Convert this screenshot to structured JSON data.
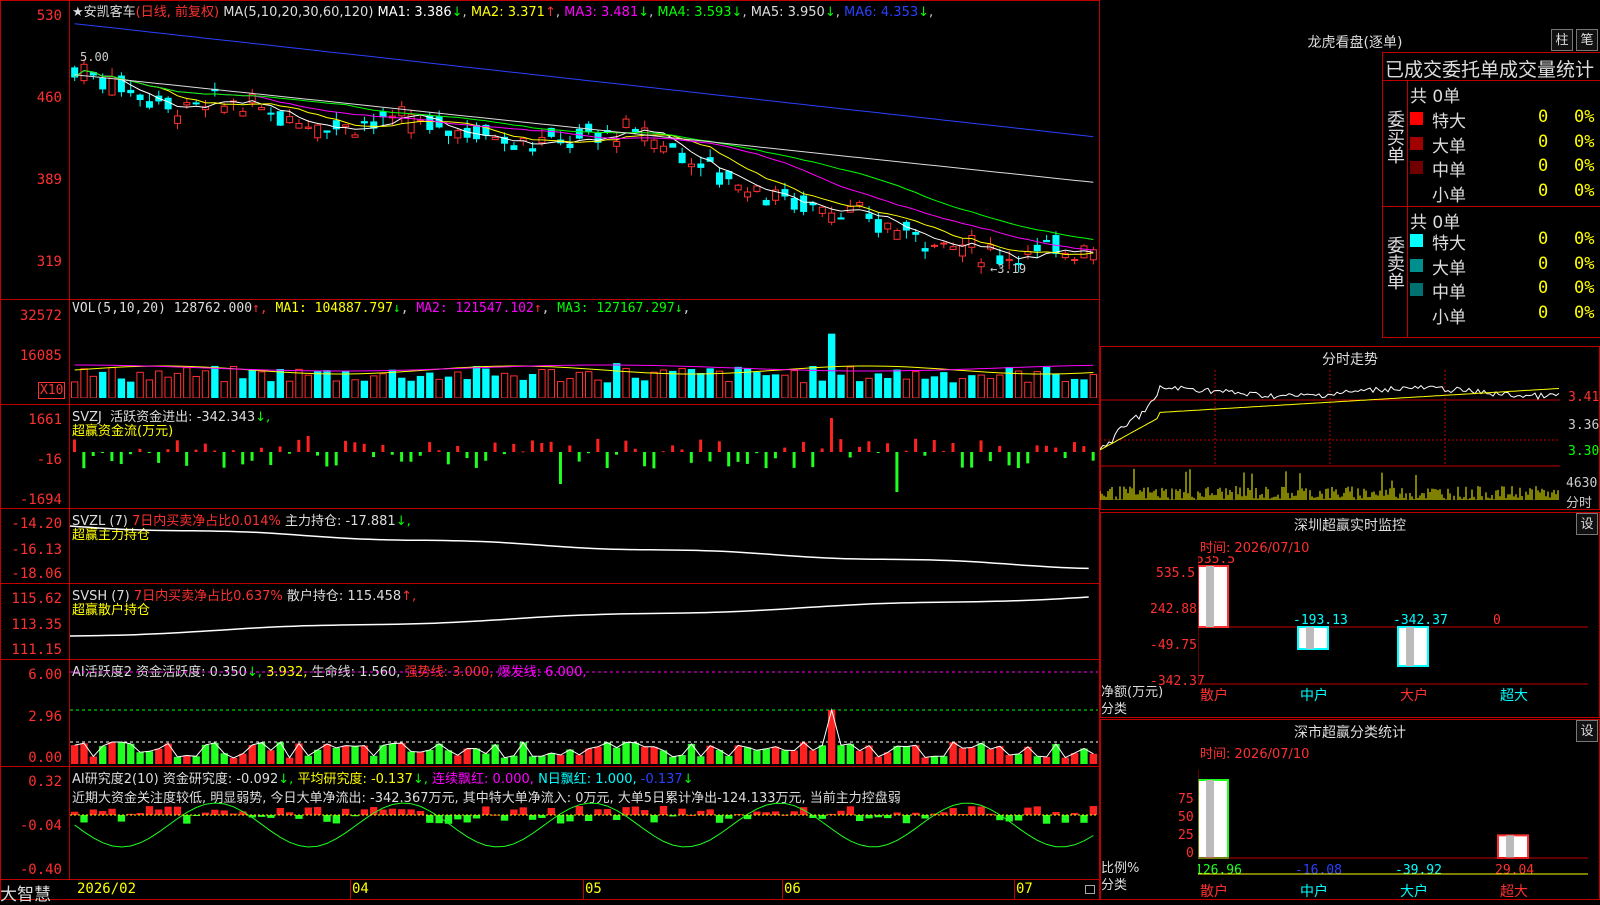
{
  "stock": {
    "name": "★安凯客车",
    "mode": "(日线, 前复权)",
    "ma_label": "MA(5,10,20,30,60,120)",
    "ma": [
      {
        "k": "MA1",
        "v": "3.386",
        "arrow": "↓",
        "color": "#ffffff"
      },
      {
        "k": "MA2",
        "v": "3.371",
        "arrow": "↑",
        "color": "#ffff00"
      },
      {
        "k": "MA3",
        "v": "3.481",
        "arrow": "↓",
        "color": "#ff00ff"
      },
      {
        "k": "MA4",
        "v": "3.593",
        "arrow": "↓",
        "color": "#00ff00"
      },
      {
        "k": "MA5",
        "v": "3.950",
        "arrow": "↓",
        "color": "#dddddd"
      },
      {
        "k": "MA6",
        "v": "4.353",
        "arrow": "↓",
        "color": "#2a40ff"
      }
    ],
    "price_axis": [
      "530",
      "460",
      "389",
      "319"
    ],
    "max_label": "5.00",
    "min_label": "←3.19"
  },
  "vol": {
    "label": "VOL(5,10,20)",
    "value": "128762.000",
    "ma": [
      {
        "k": "MA1",
        "v": "104887.797",
        "arrow": "↓",
        "color": "#ffff00"
      },
      {
        "k": "MA2",
        "v": "121547.102",
        "arrow": "↑",
        "color": "#ff00ff"
      },
      {
        "k": "MA3",
        "v": "127167.297",
        "arrow": "↓",
        "color": "#00ff00"
      }
    ],
    "axis": [
      "32572",
      "16085"
    ],
    "unit": "X10"
  },
  "svzj": {
    "label": "SVZJ",
    "item": "活跃资金进出:",
    "value": "-342.343",
    "arrow": "↓,",
    "sub": "超赢资金流(万元)",
    "axis": [
      "1661",
      "-16",
      "-1694"
    ]
  },
  "svzl": {
    "label": "SVZL (7)",
    "ratio": "7日内买卖净占比0.014%",
    "item": "主力持仓:",
    "value": "-17.881",
    "arrow": "↓,",
    "sub": "超赢主力持仓",
    "axis": [
      "-14.20",
      "-16.13",
      "-18.06"
    ]
  },
  "svsh": {
    "label": "SVSH (7)",
    "ratio": "7日内买卖净占比0.637%",
    "item": "散户持仓:",
    "value": "115.458",
    "arrow": "↑,",
    "sub": "超赢散户持仓",
    "axis": [
      "115.62",
      "113.35",
      "111.15"
    ]
  },
  "ai1": {
    "label": "AI活跃度2",
    "item": "资金活跃度:",
    "value": "0.350",
    "arrow": "↓,",
    "v2": "3.932,",
    "item2": "生命线:",
    "v3": "1.560,",
    "strong": "强势线: 3.000,",
    "burst": "爆发线: 6.000,",
    "axis": [
      "6.00",
      "2.96",
      "0.00"
    ]
  },
  "ai2": {
    "label": "AI研究度2(10)",
    "item": "资金研究度:",
    "value": "-0.092",
    "arrow": "↓,",
    "avg": "平均研究度: -0.137",
    "avg_arrow": "↓,",
    "cont": "连续飘红: 0.000,",
    "n": "N日飘红: 1.000,",
    "last": "-0.137",
    "last_arrow": "↓",
    "comment": "近期大资金关注度较低, 明显弱势, 今日大单净流出: -342.367万元, 其中特大单净流入: 0万元, 大单5日累计净出-124.133万元, 当前主力控盘弱",
    "axis": [
      "0.32",
      "-0.04",
      "-0.40"
    ]
  },
  "timeline": {
    "brand": "大智慧",
    "dates": [
      "2026/02",
      "04",
      "05",
      "06",
      "07"
    ]
  },
  "longhu": {
    "title": "龙虎看盘(逐单)",
    "btn1": "柱",
    "btn2": "笔",
    "header": "已成交委托单成交量统计",
    "buy_side": "委买单",
    "sell_side": "委卖单",
    "buy_total": "共 0单",
    "sell_total": "共 0单",
    "buy_rows": [
      {
        "name": "特大",
        "val": "0",
        "pct": "0%",
        "color": "#ff0000"
      },
      {
        "name": "大单",
        "val": "0",
        "pct": "0%",
        "color": "#a00000"
      },
      {
        "name": "中单",
        "val": "0",
        "pct": "0%",
        "color": "#700000"
      },
      {
        "name": "小单",
        "val": "0",
        "pct": "0%",
        "color": "#000000"
      }
    ],
    "sell_rows": [
      {
        "name": "特大",
        "val": "0",
        "pct": "0%",
        "color": "#00ffff"
      },
      {
        "name": "大单",
        "val": "0",
        "pct": "0%",
        "color": "#008f8f"
      },
      {
        "name": "中单",
        "val": "0",
        "pct": "0%",
        "color": "#007070"
      },
      {
        "name": "小单",
        "val": "0",
        "pct": "0%",
        "color": "#000000"
      }
    ]
  },
  "intraday": {
    "title": "分时走势",
    "prices": [
      "3.415",
      "3.360",
      "3.305"
    ],
    "vol": "4630",
    "vol_unit": "分时"
  },
  "monitor": {
    "title": "深圳超赢实时监控",
    "btn": "设",
    "date": "时间: 2026/07/10",
    "axis": [
      "535.5",
      "242.88",
      "-49.75",
      "-342.37"
    ],
    "unit": "净额(万元)",
    "cat_label": "分类",
    "values": [
      "535.5",
      "-193.13",
      "-342.37",
      "0"
    ],
    "cats": [
      "散户",
      "中户",
      "大户",
      "超大"
    ]
  },
  "stats": {
    "title": "深市超赢分类统计",
    "btn": "设",
    "date": "时间: 2026/07/10",
    "axis": [
      "75",
      "50",
      "25",
      "0"
    ],
    "unit": "比例%",
    "cat_label": "分类",
    "values": [
      "126.96",
      "-16.08",
      "-39.92",
      "29.04"
    ],
    "cats": [
      "散户",
      "中户",
      "大户",
      "超大"
    ]
  },
  "chart_data": [
    {
      "type": "candlestick",
      "title": "安凯客车 日线 前复权",
      "ylim": [
        3.0,
        5.4
      ],
      "x": [
        "2026/02",
        "04",
        "05",
        "06",
        "07"
      ],
      "close_trend": [
        4.95,
        4.8,
        4.6,
        4.65,
        4.55,
        4.45,
        4.5,
        4.45,
        4.4,
        4.3,
        4.35,
        4.4,
        4.2,
        3.95,
        3.8,
        3.7,
        3.55,
        3.45,
        3.3,
        3.35,
        3.38
      ],
      "series": [
        {
          "name": "MA1",
          "last": 3.386
        },
        {
          "name": "MA2",
          "last": 3.371
        },
        {
          "name": "MA3",
          "last": 3.481
        },
        {
          "name": "MA4",
          "last": 3.593
        },
        {
          "name": "MA5",
          "last": 3.95
        },
        {
          "name": "MA6",
          "last": 4.353
        }
      ]
    },
    {
      "type": "bar",
      "title": "VOL(5,10,20)",
      "last": 128762.0,
      "ylim": [
        0,
        32572
      ]
    },
    {
      "type": "bar",
      "title": "超赢资金流(万元)",
      "last": -342.343,
      "ylim": [
        -1694,
        1661
      ]
    },
    {
      "type": "bar",
      "title": "深圳超赢实时监控",
      "categories": [
        "散户",
        "中户",
        "大户",
        "超大"
      ],
      "values": [
        535.5,
        -193.13,
        -342.37,
        0
      ]
    },
    {
      "type": "bar",
      "title": "深市超赢分类统计",
      "categories": [
        "散户",
        "中户",
        "大户",
        "超大"
      ],
      "values": [
        126.96,
        -16.08,
        -39.92,
        29.04
      ]
    }
  ]
}
